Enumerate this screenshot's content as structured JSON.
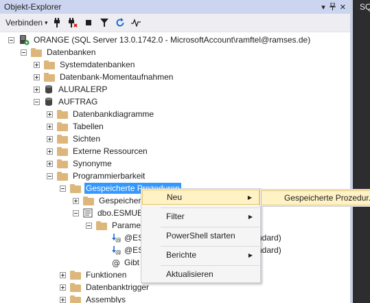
{
  "panel": {
    "title": "Objekt-Explorer",
    "controls": [
      "▾",
      "⊥",
      "✕"
    ]
  },
  "toolbar": {
    "connect_label": "Verbinden",
    "connect_arrow": "▾"
  },
  "right_tab": {
    "label": "SQ"
  },
  "tree": {
    "server": "ORANGE (SQL Server 13.0.1742.0 - MicrosoftAccount\\ramftel@ramses.de)",
    "databases": "Datenbanken",
    "systemdb": "Systemdatenbanken",
    "snapshots": "Datenbank-Momentaufnahmen",
    "aluralerp": "ALURALERP",
    "auftrag": "AUFTRAG",
    "diagrams": "Datenbankdiagramme",
    "tables": "Tabellen",
    "views": "Sichten",
    "external": "Externe Ressourcen",
    "synonyms": "Synonyme",
    "programmability": "Programmierbarkeit",
    "stored_procs": "Gespeicherte Prozeduren",
    "stored_procs_sub": "Gespeichert",
    "proc_esmue": "dbo.ESMUE",
    "params": "Paramet",
    "param1": "@ES",
    "param1_tail": "ndard)",
    "param2": "@ES",
    "param2_tail": "ndard)",
    "param3": "Gibt",
    "functions": "Funktionen",
    "db_triggers": "Datenbanktrigger",
    "assemblys": "Assemblys"
  },
  "context_menu": {
    "items": [
      "Neu",
      "Filter",
      "PowerShell starten",
      "Berichte",
      "Aktualisieren"
    ],
    "arrow": "▶"
  },
  "submenu": {
    "item": "Gespeicherte Prozedur..."
  },
  "colors": {
    "accent": "#3399ff",
    "menu_highlight": "#fff2c5",
    "folder": "#dcb67a",
    "titlebar": "#ccd5f0"
  }
}
